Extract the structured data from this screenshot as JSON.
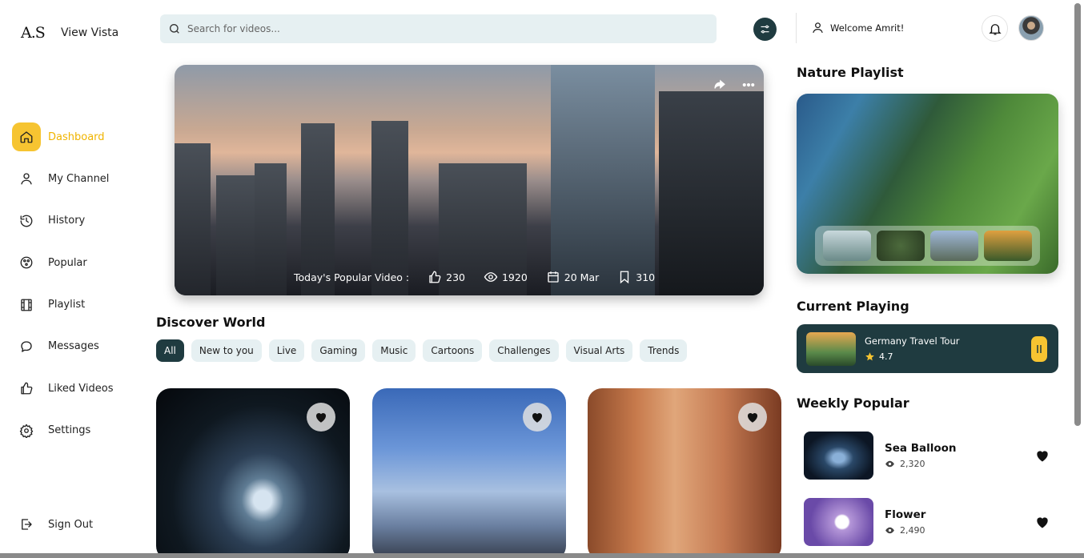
{
  "brand": {
    "logo_mark": "A.S",
    "name": "View Vista"
  },
  "search": {
    "placeholder": "Search for videos..."
  },
  "user": {
    "welcome": "Welcome Amrit!"
  },
  "sidebar": {
    "items": [
      {
        "label": "Dashboard",
        "icon": "home-icon",
        "active": true
      },
      {
        "label": "My Channel",
        "icon": "user-icon"
      },
      {
        "label": "History",
        "icon": "history-icon"
      },
      {
        "label": "Popular",
        "icon": "popular-icon"
      },
      {
        "label": "Playlist",
        "icon": "film-icon"
      },
      {
        "label": "Messages",
        "icon": "message-icon"
      },
      {
        "label": "Liked Videos",
        "icon": "thumbs-up-icon"
      },
      {
        "label": "Settings",
        "icon": "gear-icon"
      }
    ],
    "signout": "Sign Out"
  },
  "hero": {
    "label": "Today's Popular Video :",
    "likes": "230",
    "views": "1920",
    "date": "20 Mar",
    "saves": "310"
  },
  "discover": {
    "title": "Discover World",
    "chips": [
      "All",
      "New to you",
      "Live",
      "Gaming",
      "Music",
      "Cartoons",
      "Challenges",
      "Visual Arts",
      "Trends"
    ],
    "active_chip": "All"
  },
  "nature_playlist": {
    "title": "Nature Playlist"
  },
  "current_playing": {
    "title": "Current Playing",
    "video_title": "Germany Travel Tour",
    "rating": "4.7"
  },
  "weekly_popular": {
    "title": "Weekly Popular",
    "items": [
      {
        "title": "Sea Balloon",
        "views": "2,320"
      },
      {
        "title": "Flower",
        "views": "2,490"
      }
    ]
  },
  "colors": {
    "accent": "#f6c431",
    "dark": "#1f3b40",
    "chip_bg": "#e6f0f2"
  }
}
